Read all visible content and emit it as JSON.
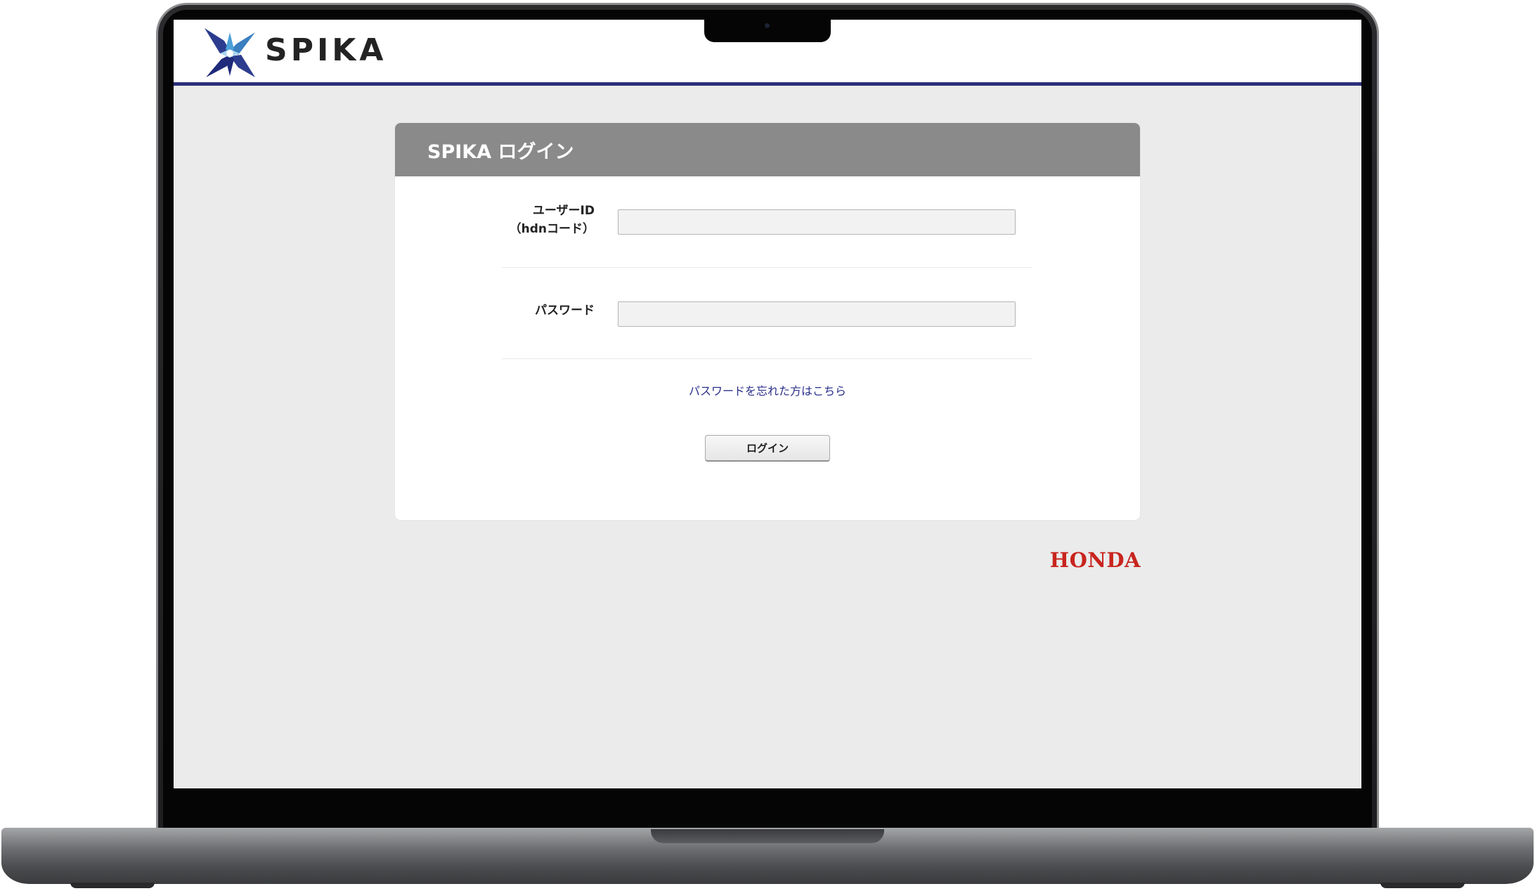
{
  "header": {
    "logo_text": "SPIKA",
    "accent_color": "#2c2f7a"
  },
  "login": {
    "title": "SPIKA ログイン",
    "user_id_label_line1": "ユーザーID",
    "user_id_label_line2": "（hdnコード）",
    "user_id_value": "",
    "password_label": "パスワード",
    "password_value": "",
    "forgot_link": "パスワードを忘れた方はこちら",
    "login_button": "ログイン"
  },
  "footer": {
    "brand": "HONDA",
    "brand_color": "#c8251e"
  },
  "icons": {
    "logo_mark": "spika-star-logo-icon",
    "camera": "camera-icon"
  }
}
